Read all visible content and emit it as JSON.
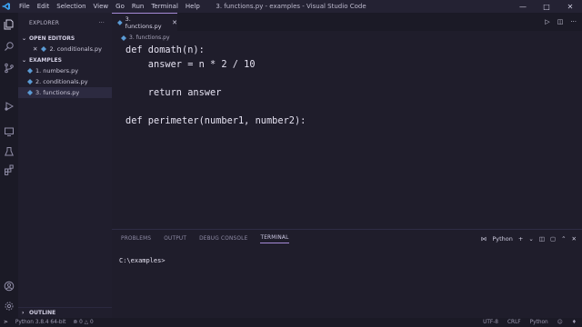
{
  "window": {
    "title": "3. functions.py - examples - Visual Studio Code",
    "menu": [
      "File",
      "Edit",
      "Selection",
      "View",
      "Go",
      "Run",
      "Terminal",
      "Help"
    ]
  },
  "sidebar": {
    "header": "EXPLORER",
    "more": "···",
    "open_editors_label": "OPEN EDITORS",
    "open_editors": [
      {
        "label": "2. conditionals.py"
      }
    ],
    "folder_label": "EXAMPLES",
    "files": [
      {
        "label": "1. numbers.py"
      },
      {
        "label": "2. conditionals.py"
      },
      {
        "label": "3. functions.py"
      }
    ],
    "outline_label": "OUTLINE"
  },
  "editor": {
    "tab_label": "3. functions.py",
    "breadcrumb": "3. functions.py",
    "lines": [
      "def domath(n):",
      "    answer = n * 2 / 10",
      "",
      "    return answer",
      "",
      "def perimeter(number1, number2):"
    ]
  },
  "panel": {
    "tabs": [
      "PROBLEMS",
      "OUTPUT",
      "DEBUG CONSOLE",
      "TERMINAL"
    ],
    "active_tab": "TERMINAL",
    "shell": "Python",
    "terminal_text": "C:\\examples>"
  },
  "statusbar": {
    "interpreter": "Python 3.8.4 64-bit",
    "errors": "0",
    "warnings": "0",
    "encoding": "UTF-8",
    "eol": "CRLF",
    "language": "Python"
  },
  "colors": {
    "accent": "#a58ad6",
    "python_icon": "#5b9bd5",
    "background": "#1f1d2b"
  }
}
